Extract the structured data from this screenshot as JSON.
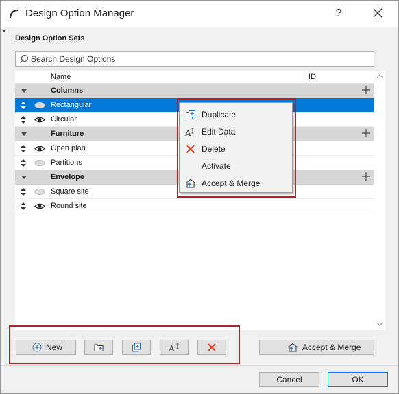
{
  "window": {
    "title": "Design Option Manager",
    "help_glyph": "?"
  },
  "section": {
    "label": "Design Option Sets"
  },
  "search": {
    "placeholder": "Search Design Options",
    "value": ""
  },
  "table": {
    "columns": [
      "Name",
      "ID"
    ],
    "groups": [
      {
        "name": "Columns",
        "items": [
          {
            "name": "Rectangular",
            "visible": false,
            "selected": true
          },
          {
            "name": "Circular",
            "visible": true,
            "selected": false
          }
        ]
      },
      {
        "name": "Furniture",
        "items": [
          {
            "name": "Open plan",
            "visible": true,
            "selected": false
          },
          {
            "name": "Partitions",
            "visible": false,
            "selected": false
          }
        ]
      },
      {
        "name": "Envelope",
        "items": [
          {
            "name": "Square site",
            "visible": false,
            "selected": false
          },
          {
            "name": "Round site",
            "visible": true,
            "selected": false
          }
        ]
      }
    ]
  },
  "context_menu": {
    "items": [
      {
        "label": "Duplicate",
        "icon": "duplicate-icon"
      },
      {
        "label": "Edit Data",
        "icon": "edit-data-icon"
      },
      {
        "label": "Delete",
        "icon": "delete-icon"
      },
      {
        "label": "Activate",
        "icon": ""
      },
      {
        "label": "Accept & Merge",
        "icon": "accept-merge-icon"
      }
    ]
  },
  "toolbar": {
    "new_label": "New",
    "accept_merge_label": "Accept & Merge",
    "icons": [
      "new-option-set-icon",
      "duplicate-icon",
      "edit-data-icon",
      "delete-icon"
    ]
  },
  "footer": {
    "cancel_label": "Cancel",
    "ok_label": "OK"
  },
  "colors": {
    "selection": "#0078d7",
    "group_row": "#d6d6d6",
    "highlight_box": "#b1222c",
    "delete_red": "#e03a1e",
    "icon_blue": "#2a6fb8"
  }
}
